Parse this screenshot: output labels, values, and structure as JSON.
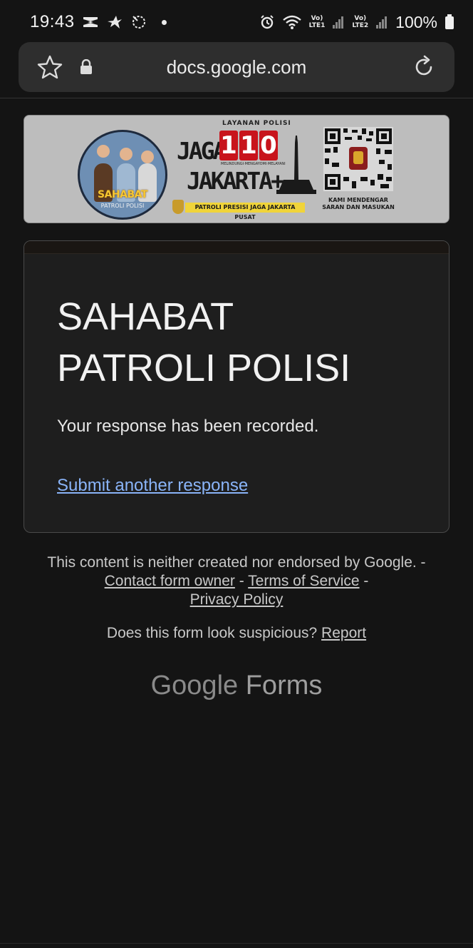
{
  "status_bar": {
    "time": "19:43",
    "net_sim1_top": "Vo)",
    "net_sim1_bottom": "LTE1",
    "net_sim2_top": "Vo)",
    "net_sim2_bottom": "LTE2",
    "battery": "100%"
  },
  "browser": {
    "url": "docs.google.com"
  },
  "banner": {
    "badge_title": "SAHABAT",
    "badge_subtitle": "PATROLI POLISI",
    "top_label": "LAYANAN POLISI",
    "jaga": "JAGA",
    "jakarta": "JAKARTA+",
    "number_digits": [
      "1",
      "1",
      "0"
    ],
    "number_subtitle": "MELINDUNGI·MENGAYOMI·MELAYANI",
    "strip": "PATROLI PRESISI JAGA JAKARTA PUSAT",
    "qr_caption_line1": "KAMI MENDENGAR",
    "qr_caption_line2": "SARAN DAN MASUKAN"
  },
  "form": {
    "title_line1": "SAHABAT",
    "title_line2": "PATROLI POLISI",
    "confirmation": "Your response has been recorded.",
    "submit_another": "Submit another response"
  },
  "footer": {
    "disclaimer_prefix": "This content is neither created nor endorsed by Google. - ",
    "contact_owner": "Contact form owner",
    "sep1": " - ",
    "terms": "Terms of Service",
    "sep2": " - ",
    "privacy": "Privacy Policy",
    "suspicious_prefix": "Does this form look suspicious? ",
    "report": "Report",
    "logo_google": "Google",
    "logo_forms": "Forms"
  }
}
